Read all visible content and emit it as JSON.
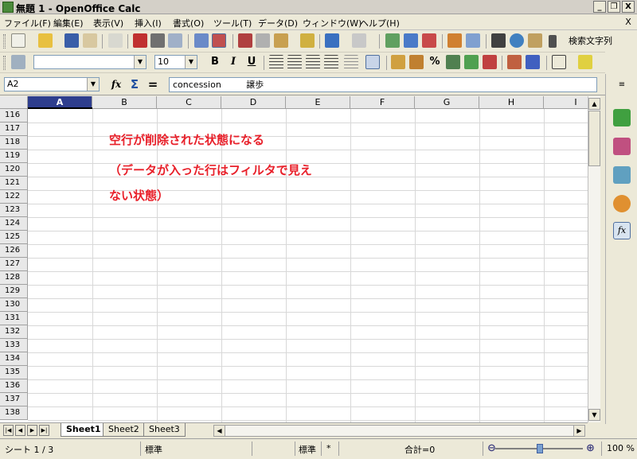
{
  "window": {
    "title": "無題 1 - OpenOffice Calc",
    "buttons": [
      "_",
      "❐",
      "X"
    ]
  },
  "menu": {
    "items": [
      "ファイル(F)",
      "編集(E)",
      "表示(V)",
      "挿入(I)",
      "書式(O)",
      "ツール(T)",
      "データ(D)",
      "ウィンドウ(W)",
      "ヘルプ(H)"
    ],
    "close": "X"
  },
  "toolbar": {
    "search_label": "検索文字列"
  },
  "format": {
    "font_name": "",
    "font_size": "10",
    "bold": "B",
    "italic": "I",
    "underline": "U",
    "percent": "%"
  },
  "formula": {
    "cell_ref": "A2",
    "fx": "fx",
    "sum": "Σ",
    "equals": "=",
    "content": "concession         譲歩"
  },
  "grid": {
    "columns": [
      "A",
      "B",
      "C",
      "D",
      "E",
      "F",
      "G",
      "H",
      "I"
    ],
    "selected_column": "A",
    "rows": [
      "116",
      "117",
      "118",
      "119",
      "120",
      "121",
      "122",
      "123",
      "124",
      "125",
      "126",
      "127",
      "128",
      "129",
      "130",
      "131",
      "132",
      "133",
      "134",
      "135",
      "136",
      "137",
      "138"
    ]
  },
  "annotation": {
    "line1": "空行が削除された状態になる",
    "line2": "（データが入った行はフィルタで見え",
    "line3": "ない状態）",
    "color": "#e8202a"
  },
  "sheets": {
    "tabs": [
      "Sheet1",
      "Sheet2",
      "Sheet3"
    ],
    "active": "Sheet1"
  },
  "status": {
    "sheet": "シート 1 / 3",
    "style": "標準",
    "mode": "標準",
    "modified": "*",
    "sum": "合計=0",
    "zoom": "100 %"
  },
  "colors": {
    "selected_header": "#2e3e8e",
    "toolbar_bg": "#ece9d8"
  }
}
